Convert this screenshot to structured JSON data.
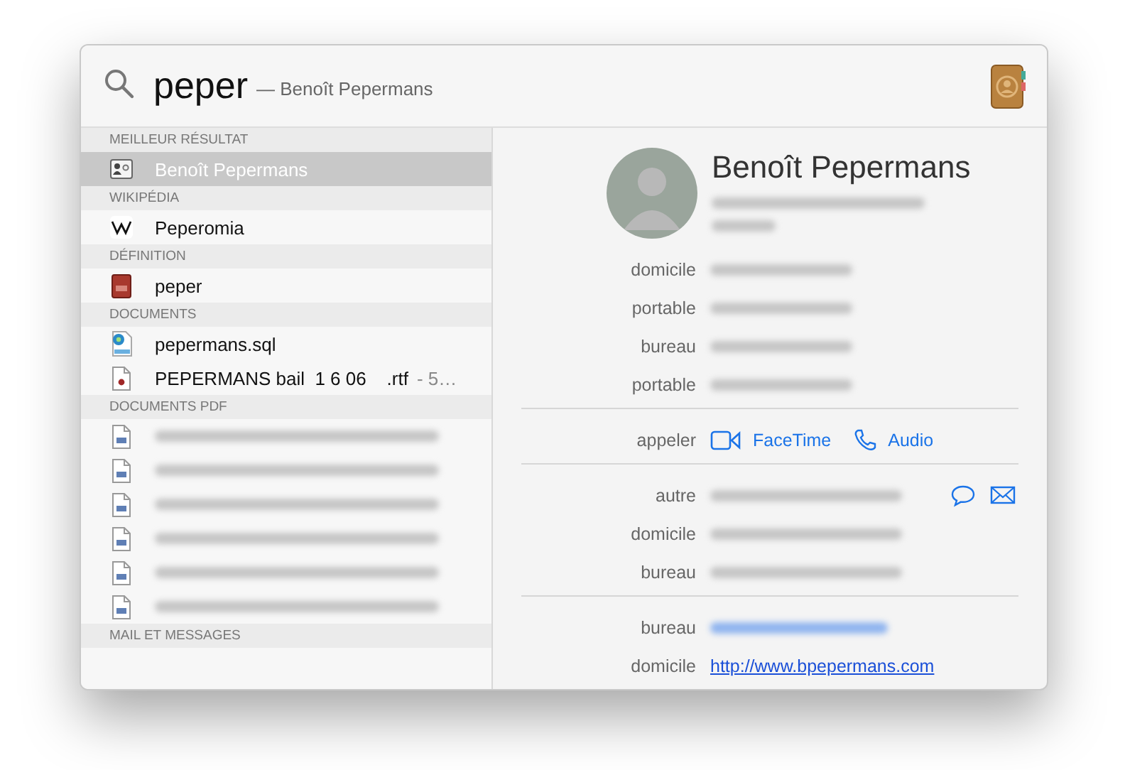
{
  "search": {
    "query": "peper",
    "suggestion": "— Benoît Pepermans"
  },
  "sections": [
    {
      "title": "MEILLEUR RÉSULTAT",
      "items": [
        {
          "kind": "contact",
          "label": "Benoît Pepermans",
          "selected": true
        }
      ]
    },
    {
      "title": "WIKIPÉDIA",
      "items": [
        {
          "kind": "wiki",
          "label": "Peperomia",
          "selected": false
        }
      ]
    },
    {
      "title": "DÉFINITION",
      "items": [
        {
          "kind": "dictionary",
          "label": "peper",
          "selected": false
        }
      ]
    },
    {
      "title": "DOCUMENTS",
      "items": [
        {
          "kind": "sql",
          "label": "pepermans.sql",
          "selected": false
        },
        {
          "kind": "rtf",
          "label": "PEPERMANS bail  1 6 06    .rtf",
          "detail": "- 5…",
          "selected": false
        }
      ]
    },
    {
      "title": "DOCUMENTS PDF",
      "items": [
        {
          "kind": "pdf",
          "blurred": true,
          "selected": false
        },
        {
          "kind": "pdf",
          "blurred": true,
          "selected": false
        },
        {
          "kind": "pdf",
          "blurred": true,
          "selected": false
        },
        {
          "kind": "pdf",
          "blurred": true,
          "selected": false
        },
        {
          "kind": "pdf",
          "blurred": true,
          "selected": false
        },
        {
          "kind": "pdf",
          "blurred": true,
          "selected": false
        }
      ]
    },
    {
      "title": "MAIL ET MESSAGES"
    }
  ],
  "contact": {
    "name": "Benoît Pepermans",
    "subtitle_blurred": true,
    "phones": [
      {
        "label": "domicile",
        "blurred": true
      },
      {
        "label": "portable",
        "blurred": true
      },
      {
        "label": "bureau",
        "blurred": true
      },
      {
        "label": "portable",
        "blurred": true
      }
    ],
    "call": {
      "label": "appeler",
      "actions": [
        {
          "kind": "video",
          "label": "FaceTime"
        },
        {
          "kind": "phone",
          "label": "Audio"
        }
      ]
    },
    "emails": [
      {
        "label": "autre",
        "blurred": true,
        "icons": [
          {
            "kind": "message"
          },
          {
            "kind": "mail"
          }
        ]
      },
      {
        "label": "domicile",
        "blurred": true
      },
      {
        "label": "bureau",
        "blurred": true
      }
    ],
    "urls": [
      {
        "label": "bureau",
        "blurred": true
      },
      {
        "label": "domicile",
        "url": "http://www.bpepermans.com"
      }
    ]
  }
}
